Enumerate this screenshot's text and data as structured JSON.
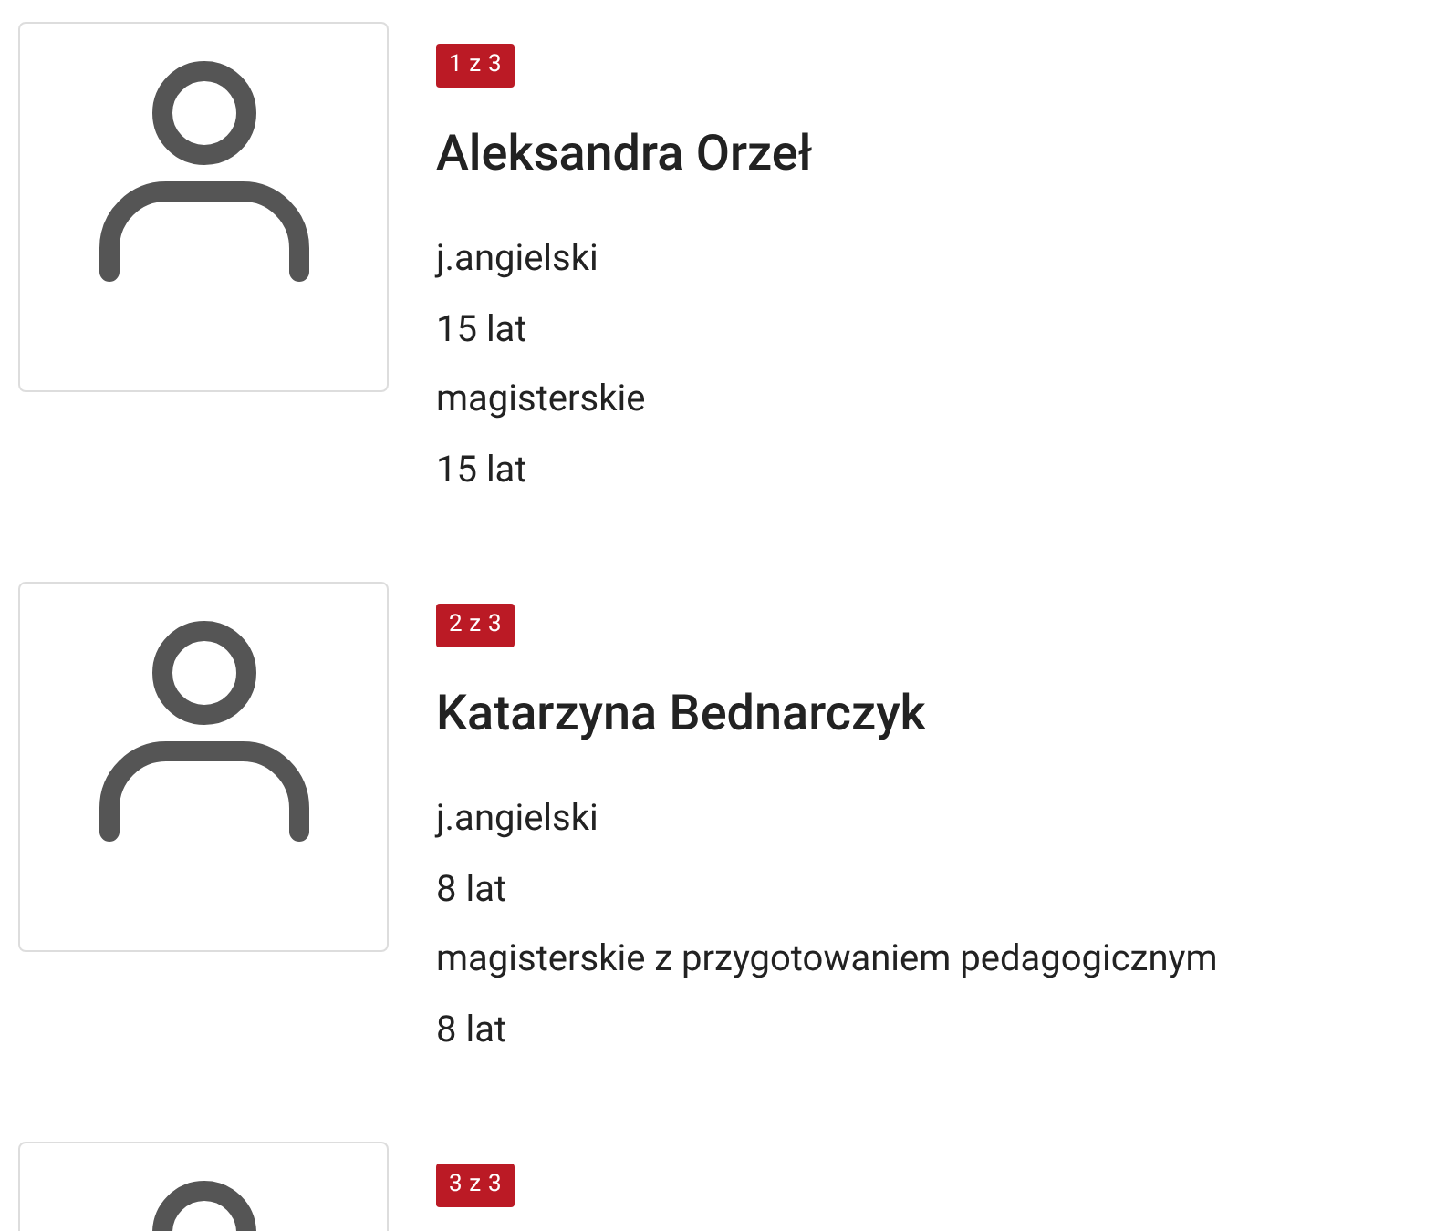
{
  "people": [
    {
      "badge": "1 z 3",
      "name": "Aleksandra Orzeł",
      "details": [
        "j.angielski",
        "15 lat",
        "magisterskie",
        "15 lat"
      ]
    },
    {
      "badge": "2 z 3",
      "name": "Katarzyna Bednarczyk",
      "details": [
        "j.angielski",
        "8 lat",
        "magisterskie z przygotowaniem pedagogicznym",
        "8 lat"
      ]
    },
    {
      "badge": "3 z 3"
    }
  ]
}
